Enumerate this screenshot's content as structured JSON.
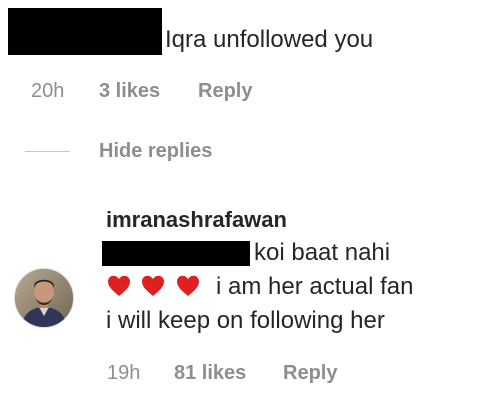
{
  "comment1": {
    "text": "Iqra unfollowed you",
    "time": "20h",
    "likes": "3 likes",
    "reply": "Reply"
  },
  "replies_toggle": {
    "label": "Hide replies"
  },
  "comment2": {
    "username": "imranashrafawan",
    "line1": "koi baat nahi",
    "line2": "i am her actual fan",
    "line3": "i will keep on following her",
    "emoji": [
      "red-heart",
      "red-heart",
      "red-heart"
    ],
    "time": "19h",
    "likes": "81 likes",
    "reply": "Reply"
  },
  "colors": {
    "text": "#262626",
    "meta": "#8e8e8e",
    "heart": "#e0201f",
    "redaction": "#000000"
  }
}
